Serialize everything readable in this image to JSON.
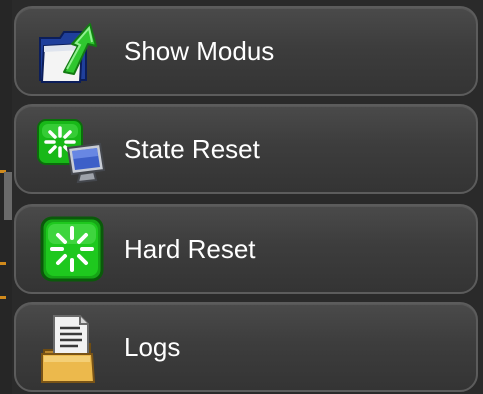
{
  "menu": {
    "items": [
      {
        "label": "Show Modus",
        "icon": "folder-arrow-icon"
      },
      {
        "label": "State Reset",
        "icon": "reset-monitor-icon"
      },
      {
        "label": "Hard Reset",
        "icon": "hard-reset-icon"
      },
      {
        "label": "Logs",
        "icon": "logs-folder-icon"
      }
    ]
  },
  "colors": {
    "background": "#2a2a2a",
    "item_border": "#5c5c5c",
    "item_fill_top": "#4a4a4a",
    "item_fill_bottom": "#343434",
    "text": "#ffffff",
    "reset_green": "#19c419",
    "folder_yellow": "#e6b54a",
    "accent_orange": "#d08a1c"
  }
}
